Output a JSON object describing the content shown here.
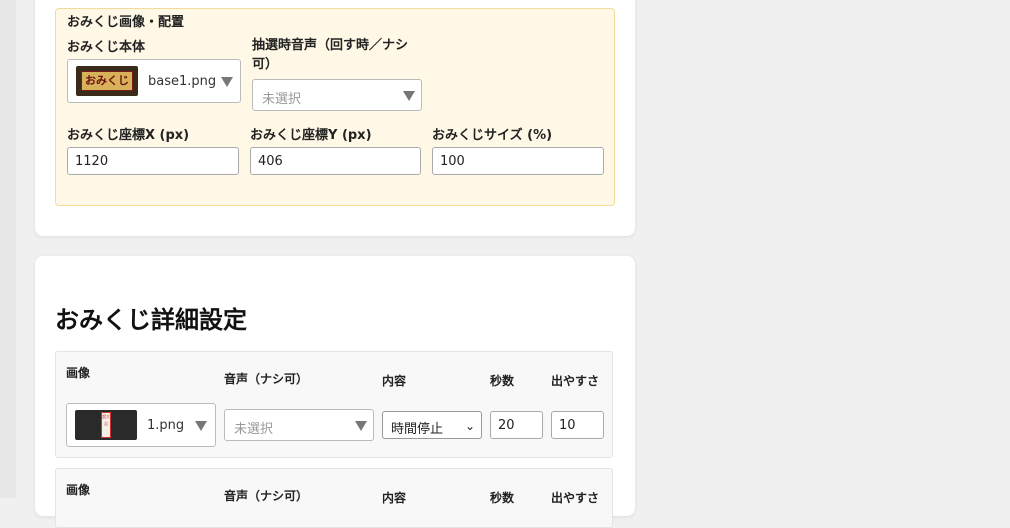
{
  "placement": {
    "section_title": "おみくじ画像・配置",
    "body_label": "おみくじ本体",
    "body_file": "base1.png",
    "body_thumb_text": "おみくじ",
    "sound_label": "抽選時音声（回す時／ナシ可）",
    "sound_placeholder": "未選択",
    "x_label": "おみくじ座標X (px)",
    "x_value": "1120",
    "y_label": "おみくじ座標Y (px)",
    "y_value": "406",
    "size_label": "おみくじサイズ (%)",
    "size_value": "100"
  },
  "details": {
    "title": "おみくじ詳細設定",
    "headers": {
      "image": "画像",
      "sound": "音声（ナシ可）",
      "content": "内容",
      "seconds": "秒数",
      "weight": "出やすさ"
    },
    "rows": [
      {
        "image_file": "1.png",
        "thumb_text": "超大吉",
        "sound_placeholder": "未選択",
        "content": "時間停止",
        "seconds": "20",
        "weight": "10"
      }
    ]
  },
  "colors": {
    "panel_bg": "#fff8e6",
    "panel_border": "#f2dc9a",
    "thumb_gold": "#d8b25a",
    "thumb_dark": "#2a2a2a",
    "thumb_red": "#d03030"
  }
}
